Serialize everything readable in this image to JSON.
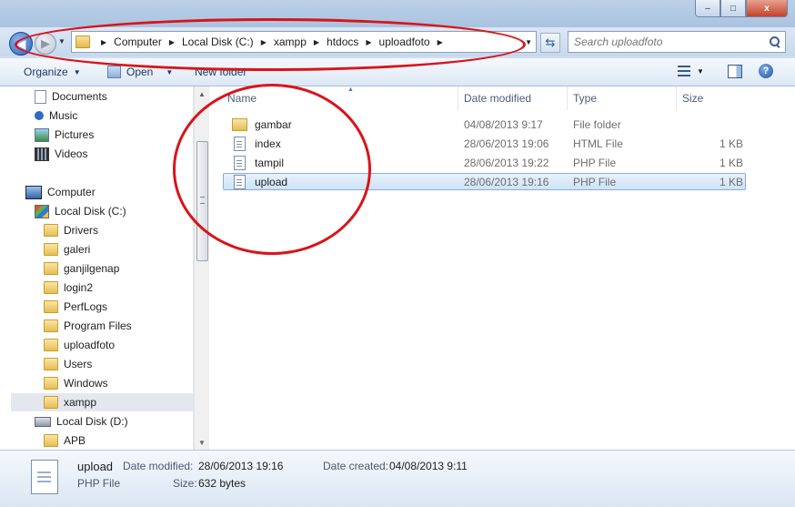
{
  "window": {
    "minimize": "–",
    "maximize": "□",
    "close": "x"
  },
  "nav": {
    "back": "◀",
    "forward": "▶",
    "breadcrumb": [
      "Computer",
      "Local Disk (C:)",
      "xampp",
      "htdocs",
      "uploadfoto"
    ],
    "refresh": "⇆",
    "search_placeholder": "Search uploadfoto"
  },
  "toolbar": {
    "organize": "Organize",
    "open": "Open",
    "new_folder": "New folder"
  },
  "columns": {
    "name": "Name",
    "date_modified": "Date modified",
    "type": "Type",
    "size": "Size"
  },
  "files": [
    {
      "name": "gambar",
      "date": "04/08/2013 9:17",
      "type": "File folder",
      "size": "",
      "icon": "folder-icon"
    },
    {
      "name": "index",
      "date": "28/06/2013 19:06",
      "type": "HTML File",
      "size": "1 KB",
      "icon": "document-icon"
    },
    {
      "name": "tampil",
      "date": "28/06/2013 19:22",
      "type": "PHP File",
      "size": "1 KB",
      "icon": "document-icon"
    },
    {
      "name": "upload",
      "date": "28/06/2013 19:16",
      "type": "PHP File",
      "size": "1 KB",
      "icon": "document-icon"
    }
  ],
  "sidebar": {
    "libraries": [
      {
        "label": "Documents",
        "icon": "documents-icon"
      },
      {
        "label": "Music",
        "icon": "music-icon"
      },
      {
        "label": "Pictures",
        "icon": "pictures-icon"
      },
      {
        "label": "Videos",
        "icon": "videos-icon"
      }
    ],
    "computer": "Computer",
    "drive_c": "Local Disk (C:)",
    "drive_c_folders": [
      "Drivers",
      "galeri",
      "ganjilgenap",
      "login2",
      "PerfLogs",
      "Program Files",
      "uploadfoto",
      "Users",
      "Windows",
      "xampp"
    ],
    "drive_d": "Local Disk (D:)",
    "drive_d_folders": [
      "APB"
    ]
  },
  "details": {
    "name": "upload",
    "type": "PHP File",
    "date_modified_label": "Date modified:",
    "date_modified": "28/06/2013 19:16",
    "size_label": "Size:",
    "size": "632 bytes",
    "date_created_label": "Date created:",
    "date_created": "04/08/2013 9:11"
  }
}
